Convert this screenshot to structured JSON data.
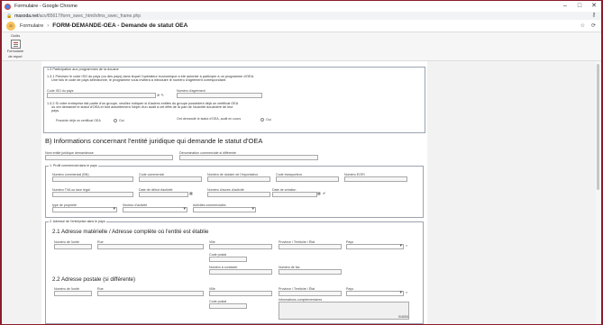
{
  "window": {
    "title": "Formulaire - Google Chrome",
    "controls": [
      "–",
      "□",
      "✕"
    ]
  },
  "address": {
    "host": "maxoda.net",
    "path": "/acv/85617/form_swec_html/sfms_swec_frame.php"
  },
  "app": {
    "logo": "O",
    "breadcrumb_root": "Formulaire",
    "breadcrumb_sep": "›",
    "page_title": "FORM-DEMANDE-OEA - Demande de statut OEA"
  },
  "ribbon": {
    "group_label": "Outils",
    "button_label_1": "Formulaire",
    "button_label_2": "de report"
  },
  "s13": {
    "title": "1.3 Participation aux programmes de la douane",
    "q1_line1": "1.3.1 Précisez le code ISO du pays (ou des pays) dans lequel l'opérateur économique a été autorisé à participer à un programme d'OEA.",
    "q1_line2": "Une fois le code de pays sélectionné, le programme vous invitera à introduire le numéro d'agrément correspondant.",
    "iso_label": "Code ISO du pays",
    "agreement_label": "Numéro d'agrément",
    "q2_line1": "1.3.2 Si votre entreprise fait partie d'un groupe, veuillez indiquer si d'autres entités du groupe possèdent déjà un certificat OEA",
    "q2_line2": "ou ont demandé le statut d'OEA et font actuellement l'objet d'un audit à cet effet de la part de l'autorité douanière de leur",
    "q2_line3": "pays.",
    "own_cert_label": "Possède déjà un certificat OEA",
    "own_cert_opt": "Oui",
    "audit_label": "Ont demandé le statut d'OEA, audit en cours",
    "audit_opt": "Oui"
  },
  "sB": {
    "title": "B) Informations concernant l'entité juridique qui demande le statut d'OEA",
    "entity_name": "Nom entité juridique demandeuse",
    "trade_name": "Dénomination commerciale si différente",
    "profile": {
      "title": "1. Profil commercial dans le pays",
      "reg_num": "Numéro commercial (BN)",
      "trade_code": "Code commercial",
      "importer_file": "Numéro de dossier de l'importateur",
      "ports_code": "Code transporteur",
      "eori": "Numéro EORI",
      "tva": "Numéro TVA ou taxe légal",
      "start_date": "Date de début d'activité",
      "activity_code": "Numéro d'accès d'activité",
      "creation_date": "Date de création",
      "ownership": "type de propriété",
      "sector": "Secteur d'activité",
      "commercial": "Activités commerciales"
    },
    "address": {
      "title": "2. Adresse de l'entreprise dans le pays",
      "physical_title": "2.1 Adresse matérielle / Adresse complète où l'entité est établie",
      "postal_title": "2.2 Adresse postale (si différente)",
      "street_num": "Numéro de l'unité",
      "street": "Rue",
      "city": "Ville",
      "province": "Province / Territoire / État",
      "country": "Pays",
      "postal_code": "Code postal",
      "contact_number": "Numéro à contacter",
      "fax": "Numéro de fax",
      "complement": "Informations complémentaires",
      "counter": "0/4000"
    }
  },
  "icons": {
    "lock": "🔒",
    "key": "⚷",
    "star": "☆",
    "refresh": "⟳",
    "calendar": "▦",
    "check": "✔",
    "close_x": "×"
  }
}
